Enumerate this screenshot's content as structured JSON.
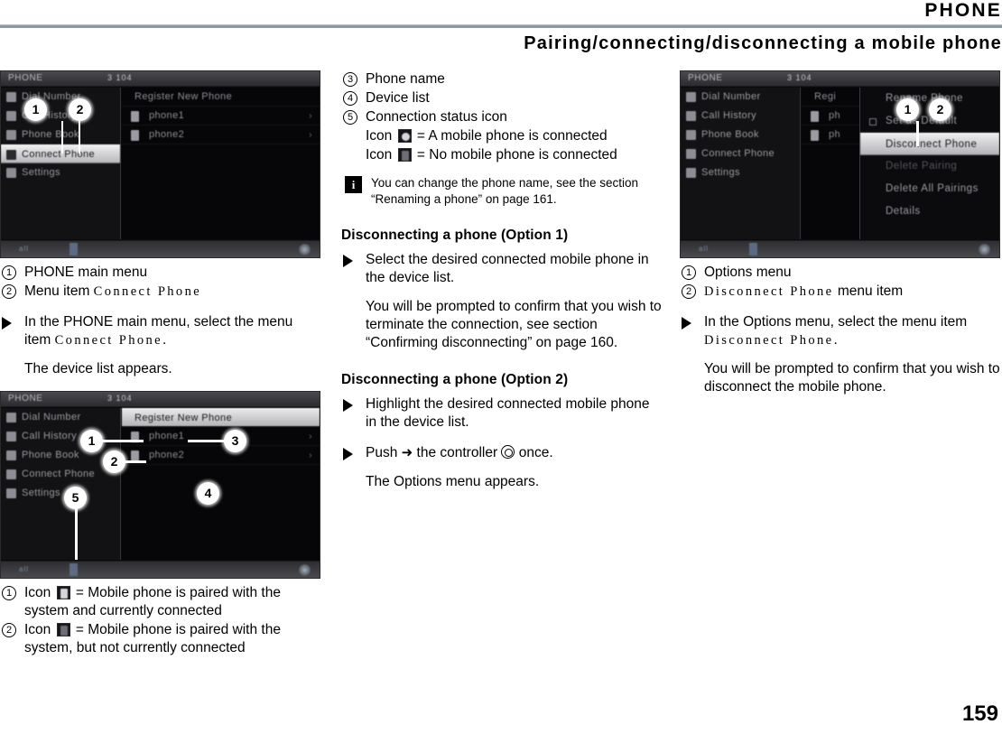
{
  "header": {
    "chapter": "PHONE",
    "section_title": "Pairing/connecting/disconnecting a mobile phone"
  },
  "page_number": "159",
  "device_screens": {
    "screen1": {
      "title": "PHONE",
      "status": "3  104",
      "menu_items": [
        "Dial Number",
        "Call History",
        "Phone Book",
        "Connect Phone",
        "Settings"
      ],
      "selected_menu_item": "Connect Phone",
      "device_list": [
        "Register New Phone",
        "phone1",
        "phone2"
      ]
    },
    "screen2": {
      "title": "PHONE",
      "status": "3  104",
      "menu_items": [
        "Dial Number",
        "Call History",
        "Phone Book",
        "Connect Phone",
        "Settings"
      ],
      "device_list": [
        "Register New Phone",
        "phone1",
        "phone2"
      ],
      "selected_device_item": "Register New Phone"
    },
    "screen3": {
      "title": "PHONE",
      "status": "3  104",
      "menu_items": [
        "Dial Number",
        "Call History",
        "Phone Book",
        "Connect Phone",
        "Settings"
      ],
      "device_list": [
        "Regi",
        "ph",
        "ph"
      ],
      "options_menu": [
        "Rename Phone",
        "Set as Default",
        "Disconnect Phone",
        "Delete Pairing",
        "Delete All Pairings",
        "Details"
      ],
      "selected_option": "Disconnect Phone"
    }
  },
  "col1": {
    "legend": [
      {
        "num": "1",
        "text": "PHONE main menu"
      },
      {
        "num": "2",
        "pre": "Menu item ",
        "menu": "Connect Phone"
      }
    ],
    "step1_pre": "In the PHONE main menu, select the menu item ",
    "step1_menu": "Connect Phone",
    "step1_post": ".",
    "step1_result": "The device list appears.",
    "legend2": [
      {
        "num": "1",
        "pre": "Icon ",
        "post": " = Mobile phone is paired with the system and currently connected"
      },
      {
        "num": "2",
        "pre": "Icon ",
        "post": " = Mobile phone is paired with the system, but not currently connected"
      }
    ]
  },
  "col2": {
    "legend": [
      {
        "num": "3",
        "text": "Phone name"
      },
      {
        "num": "4",
        "text": "Device list"
      },
      {
        "num": "5",
        "text": "Connection status icon"
      }
    ],
    "icon_line1_pre": "Icon ",
    "icon_line1_post": " = A mobile phone is connected",
    "icon_line2_pre": "Icon ",
    "icon_line2_post": " = No mobile phone is connected",
    "note": "You can change the phone name, see the section “Renaming a phone” on page 161.",
    "opt1_heading": "Disconnecting a phone (Option 1)",
    "opt1_step": "Select the desired connected mobile phone in the device list.",
    "opt1_result": "You will be prompted to confirm that you wish to terminate the connection, see section “Confirming disconnecting” on page 160.",
    "opt2_heading": "Disconnecting a phone (Option 2)",
    "opt2_step1": "Highlight the desired connected mobile phone in the device list.",
    "opt2_step2_pre": "Push ",
    "opt2_step2_arrow": "➜",
    "opt2_step2_mid": " the controller ",
    "opt2_step2_post": " once.",
    "opt2_result": "The Options menu appears."
  },
  "col3": {
    "legend": [
      {
        "num": "1",
        "text": "Options menu"
      },
      {
        "num": "2",
        "menu": "Disconnect Phone",
        "post": " menu item"
      }
    ],
    "step_pre": "In the Options menu, select the menu item ",
    "step_menu": "Disconnect Phone",
    "step_post": ".",
    "step_result": "You will be prompted to confirm that you wish to disconnect the mobile phone."
  },
  "callouts": {
    "one": "1",
    "two": "2",
    "three": "3",
    "four": "4",
    "five": "5"
  }
}
